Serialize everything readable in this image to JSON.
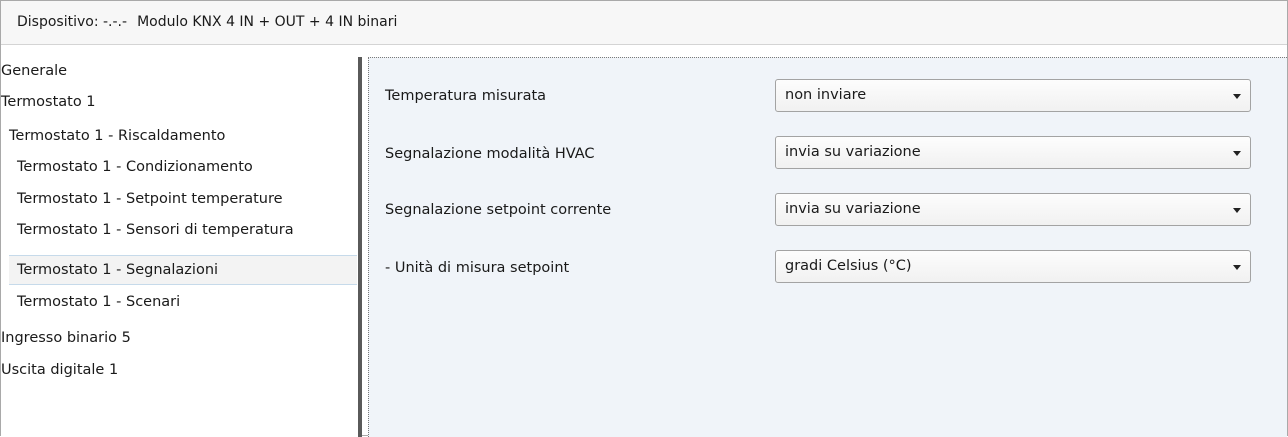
{
  "window": {
    "device_label": "Dispositivo: -.-.-",
    "device_name": "Modulo KNX 4 IN + OUT + 4 IN binari"
  },
  "sidebar": {
    "items": [
      {
        "label": "Generale"
      },
      {
        "label": "Termostato 1"
      },
      {
        "label": "Termostato 1 - Riscaldamento"
      },
      {
        "label": "Termostato 1 - Condizionamento"
      },
      {
        "label": "Termostato 1 - Setpoint temperature"
      },
      {
        "label": "Termostato 1 - Sensori di  temperatura"
      },
      {
        "label": "Termostato 1 - Segnalazioni",
        "selected": true
      },
      {
        "label": "Termostato 1 - Scenari"
      },
      {
        "label": "Ingresso binario 5"
      },
      {
        "label": "Uscita digitale 1"
      }
    ]
  },
  "params": [
    {
      "label": "Temperatura misurata",
      "value": "non inviare"
    },
    {
      "label": "Segnalazione modalità HVAC",
      "value": "invia su variazione"
    },
    {
      "label": "Segnalazione setpoint corrente",
      "value": "invia su variazione"
    },
    {
      "label": "- Unità di misura setpoint",
      "value": "gradi Celsius (°C)"
    }
  ],
  "icons": {
    "dropdown": "chevron-down-icon"
  },
  "colors": {
    "panel_background": "#f0f4f9",
    "selected_item_border": "#c6daea",
    "splitter": "#5a5a5a"
  }
}
